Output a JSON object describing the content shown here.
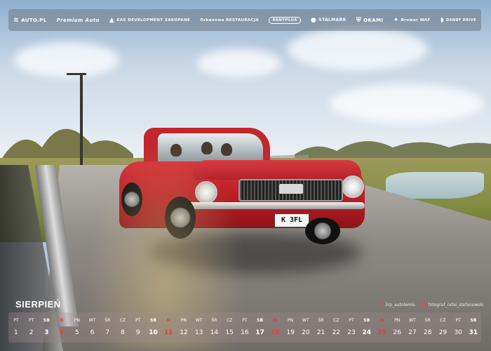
{
  "sponsors": [
    {
      "label": "AUTO.PL",
      "icon": "car-logo-icon"
    },
    {
      "label": "Premium Auto",
      "icon": "script-logo-icon"
    },
    {
      "label": "KAS DEVELOPMENT ZAKOPANE",
      "icon": "mountain-icon"
    },
    {
      "label": "Orkanowa RESTAURACJA",
      "icon": "script-logo-icon"
    },
    {
      "label": "RENTPLUS",
      "icon": "oval-logo-icon"
    },
    {
      "label": "STALMARK",
      "icon": "drop-icon"
    },
    {
      "label": "OKAMI",
      "icon": "shield-icon"
    },
    {
      "label": "Browar WAF",
      "icon": "eagle-icon"
    },
    {
      "label": "DANDY DRIVE",
      "icon": "d-logo-icon"
    }
  ],
  "calendar": {
    "month": "SIERPIEŃ",
    "credits": [
      {
        "label": "3rp_autolemis"
      },
      {
        "label": "fotograf_rafal_stefanowski"
      }
    ],
    "days": [
      {
        "name": "PT",
        "num": "1",
        "kind": "weekday"
      },
      {
        "name": "PT",
        "num": "2",
        "kind": "weekday"
      },
      {
        "name": "SB",
        "num": "3",
        "kind": "sat"
      },
      {
        "name": "N",
        "num": "4",
        "kind": "sun"
      },
      {
        "name": "PN",
        "num": "5",
        "kind": "weekday"
      },
      {
        "name": "WT",
        "num": "6",
        "kind": "weekday"
      },
      {
        "name": "ŚR",
        "num": "7",
        "kind": "weekday"
      },
      {
        "name": "CZ",
        "num": "8",
        "kind": "weekday"
      },
      {
        "name": "PT",
        "num": "9",
        "kind": "weekday"
      },
      {
        "name": "SB",
        "num": "10",
        "kind": "sat"
      },
      {
        "name": "N",
        "num": "11",
        "kind": "sun"
      },
      {
        "name": "PN",
        "num": "12",
        "kind": "weekday"
      },
      {
        "name": "WT",
        "num": "13",
        "kind": "weekday"
      },
      {
        "name": "ŚR",
        "num": "14",
        "kind": "weekday"
      },
      {
        "name": "CZ",
        "num": "15",
        "kind": "weekday"
      },
      {
        "name": "PT",
        "num": "16",
        "kind": "weekday"
      },
      {
        "name": "SB",
        "num": "17",
        "kind": "sat"
      },
      {
        "name": "N",
        "num": "18",
        "kind": "sun"
      },
      {
        "name": "PN",
        "num": "19",
        "kind": "weekday"
      },
      {
        "name": "WT",
        "num": "20",
        "kind": "weekday"
      },
      {
        "name": "ŚR",
        "num": "21",
        "kind": "weekday"
      },
      {
        "name": "CZ",
        "num": "22",
        "kind": "weekday"
      },
      {
        "name": "PT",
        "num": "23",
        "kind": "weekday"
      },
      {
        "name": "SB",
        "num": "24",
        "kind": "sat"
      },
      {
        "name": "N",
        "num": "25",
        "kind": "sun"
      },
      {
        "name": "PN",
        "num": "26",
        "kind": "weekday"
      },
      {
        "name": "WT",
        "num": "27",
        "kind": "weekday"
      },
      {
        "name": "ŚR",
        "num": "28",
        "kind": "weekday"
      },
      {
        "name": "CZ",
        "num": "29",
        "kind": "weekday"
      },
      {
        "name": "PT",
        "num": "30",
        "kind": "weekday"
      },
      {
        "name": "SB",
        "num": "31",
        "kind": "sat"
      }
    ]
  },
  "photo": {
    "plate": "K 3FL",
    "car_color": "#c4242b",
    "sunday_color": "#e83b3b"
  }
}
